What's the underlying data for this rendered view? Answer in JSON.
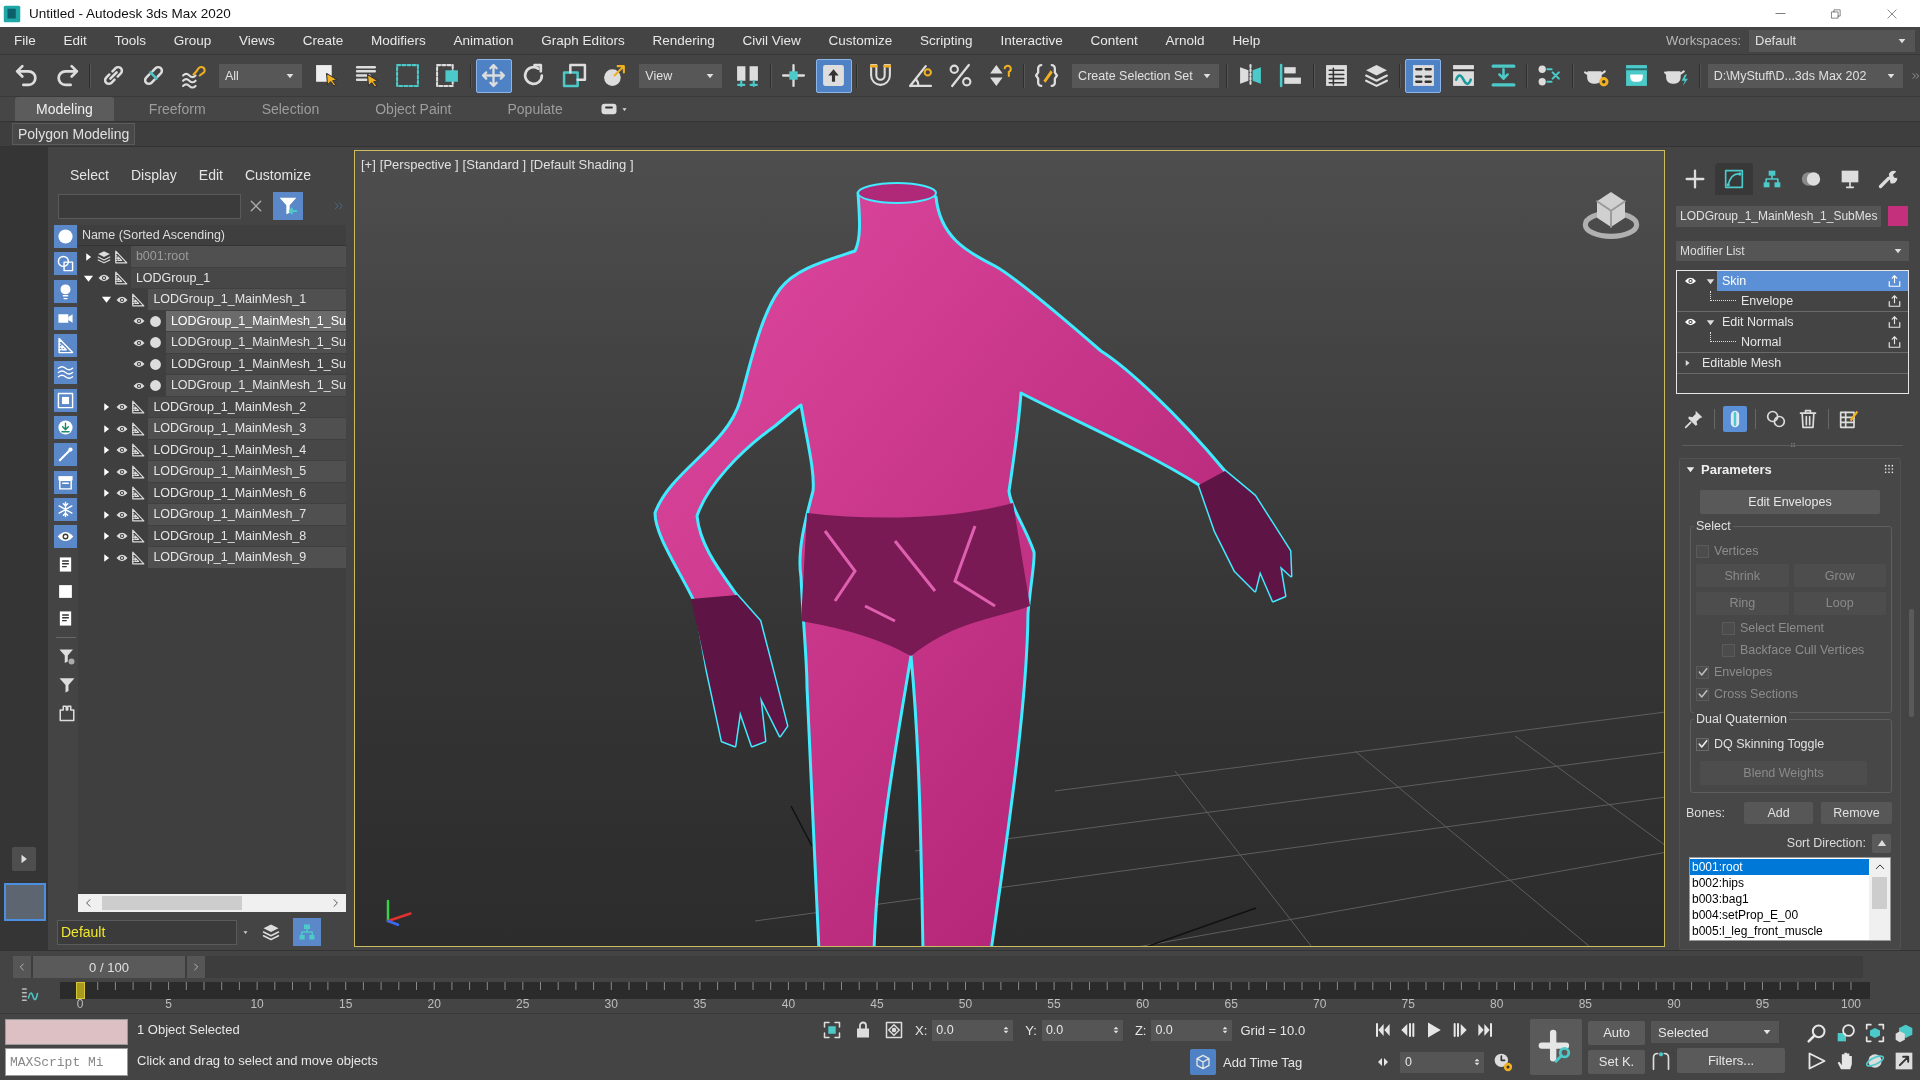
{
  "window": {
    "title": "Untitled - Autodesk 3ds Max 2020"
  },
  "menu_bar": {
    "items": [
      "File",
      "Edit",
      "Tools",
      "Group",
      "Views",
      "Create",
      "Modifiers",
      "Animation",
      "Graph Editors",
      "Rendering",
      "Civil View",
      "Customize",
      "Scripting",
      "Interactive",
      "Content",
      "Arnold",
      "Help"
    ],
    "workspaces_label": "Workspaces:",
    "workspace": "Default"
  },
  "main_toolbar": [
    {
      "kind": "button",
      "selected": false
    },
    {
      "kind": "button",
      "selected": false
    },
    {
      "kind": "separator"
    },
    {
      "kind": "button",
      "selected": false
    },
    {
      "kind": "button",
      "selected": false
    },
    {
      "kind": "button",
      "selected": false
    },
    {
      "kind": "dropdown",
      "value": "All"
    },
    {
      "kind": "button",
      "selected": false
    },
    {
      "kind": "button",
      "selected": false
    },
    {
      "kind": "button",
      "selected": false
    },
    {
      "kind": "button",
      "selected": false
    },
    {
      "kind": "separator"
    },
    {
      "kind": "button",
      "selected": true
    },
    {
      "kind": "button",
      "selected": false
    },
    {
      "kind": "button",
      "selected": false
    },
    {
      "kind": "button",
      "selected": false
    },
    {
      "kind": "dropdown",
      "value": "View"
    },
    {
      "kind": "button",
      "selected": false
    },
    {
      "kind": "separator"
    },
    {
      "kind": "button",
      "selected": false
    },
    {
      "kind": "button",
      "selected": true
    },
    {
      "kind": "separator"
    },
    {
      "kind": "button",
      "selected": false
    },
    {
      "kind": "button",
      "selected": false
    },
    {
      "kind": "button",
      "selected": false
    },
    {
      "kind": "button",
      "selected": false
    },
    {
      "kind": "separator"
    },
    {
      "kind": "button",
      "selected": false
    },
    {
      "kind": "dropdown",
      "value": "Create Selection Set"
    },
    {
      "kind": "separator"
    },
    {
      "kind": "button",
      "selected": false
    },
    {
      "kind": "button",
      "selected": false
    },
    {
      "kind": "separator"
    },
    {
      "kind": "button",
      "selected": false
    },
    {
      "kind": "button",
      "selected": false
    },
    {
      "kind": "separator"
    },
    {
      "kind": "button",
      "selected": true
    },
    {
      "kind": "button",
      "selected": false
    },
    {
      "kind": "button",
      "selected": false
    },
    {
      "kind": "separator"
    },
    {
      "kind": "button",
      "selected": false
    },
    {
      "kind": "separator"
    },
    {
      "kind": "button",
      "selected": false
    },
    {
      "kind": "button",
      "selected": false
    },
    {
      "kind": "button",
      "selected": false
    },
    {
      "kind": "separator"
    },
    {
      "kind": "dropdown",
      "value": "D:\\MyStuff\\D...3ds Max 202"
    }
  ],
  "ribbon": {
    "tabs": [
      {
        "label": "Modeling",
        "selected": true
      },
      {
        "label": "Freeform",
        "selected": false
      },
      {
        "label": "Selection",
        "selected": false
      },
      {
        "label": "Object Paint",
        "selected": false
      },
      {
        "label": "Populate",
        "selected": false
      }
    ],
    "panels": [
      "Polygon Modeling"
    ]
  },
  "viewport_layouts": [
    {
      "selected": true
    }
  ],
  "scene_explorer": {
    "menu": [
      "Select",
      "Display",
      "Edit",
      "Customize"
    ],
    "find_filter": {
      "selected": true
    },
    "filters": [
      {
        "on": true
      },
      {
        "on": true
      },
      {
        "on": true
      },
      {
        "on": true
      },
      {
        "on": true
      },
      {
        "on": true
      },
      {
        "on": true
      },
      {
        "on": true
      },
      {
        "on": true
      },
      {
        "on": true
      },
      {
        "on": true
      },
      {
        "on": true
      },
      {
        "on": false
      },
      {
        "on": false
      },
      {
        "on": false
      }
    ],
    "column": "Name (Sorted Ascending)",
    "tree": [
      {
        "name": "b001:root",
        "kind": "helper",
        "hidden": true,
        "expanded": false,
        "selected": false
      },
      {
        "name": "LODGroup_1",
        "kind": "helper",
        "hidden": false,
        "expanded": true,
        "selected": false,
        "children": [
          {
            "name": "LODGroup_1_MainMesh_1",
            "kind": "helper",
            "hidden": false,
            "expanded": true,
            "selected": false,
            "children": [
              {
                "name": "LODGroup_1_MainMesh_1_Su",
                "kind": "geometry",
                "hidden": false,
                "selected": true
              },
              {
                "name": "LODGroup_1_MainMesh_1_Su",
                "kind": "geometry",
                "hidden": false,
                "selected": false
              },
              {
                "name": "LODGroup_1_MainMesh_1_Su",
                "kind": "geometry",
                "hidden": false,
                "selected": false
              },
              {
                "name": "LODGroup_1_MainMesh_1_Su",
                "kind": "geometry",
                "hidden": false,
                "selected": false
              }
            ]
          },
          {
            "name": "LODGroup_1_MainMesh_2",
            "kind": "helper",
            "hidden": false,
            "expanded": false,
            "selected": false
          },
          {
            "name": "LODGroup_1_MainMesh_3",
            "kind": "helper",
            "hidden": false,
            "expanded": false,
            "selected": false
          },
          {
            "name": "LODGroup_1_MainMesh_4",
            "kind": "helper",
            "hidden": false,
            "expanded": false,
            "selected": false
          },
          {
            "name": "LODGroup_1_MainMesh_5",
            "kind": "helper",
            "hidden": false,
            "expanded": false,
            "selected": false
          },
          {
            "name": "LODGroup_1_MainMesh_6",
            "kind": "helper",
            "hidden": false,
            "expanded": false,
            "selected": false
          },
          {
            "name": "LODGroup_1_MainMesh_7",
            "kind": "helper",
            "hidden": false,
            "expanded": false,
            "selected": false
          },
          {
            "name": "LODGroup_1_MainMesh_8",
            "kind": "helper",
            "hidden": false,
            "expanded": false,
            "selected": false
          },
          {
            "name": "LODGroup_1_MainMesh_9",
            "kind": "helper",
            "hidden": false,
            "expanded": false,
            "selected": false
          }
        ]
      }
    ],
    "layer": "Default",
    "layer_tools": [
      {
        "selected": false
      },
      {
        "selected": true
      }
    ]
  },
  "viewport": {
    "labels": [
      "[+]",
      "[Perspective ]",
      "[Standard ]",
      "[Default Shading ]"
    ],
    "active": true
  },
  "command_panel": {
    "tabs": [
      {
        "selected": false
      },
      {
        "selected": true
      },
      {
        "selected": false
      },
      {
        "selected": false
      },
      {
        "selected": false
      },
      {
        "selected": false
      }
    ],
    "object": {
      "name": "LODGroup_1_MainMesh_1_SubMes",
      "color": "#c4307c"
    },
    "modifier_list": "Modifier List",
    "stack": [
      {
        "label": "Skin",
        "visible": true,
        "expanded": true,
        "selected": true,
        "children": [
          {
            "label": "Envelope",
            "selected": false
          }
        ]
      },
      {
        "label": "Edit Normals",
        "visible": true,
        "expanded": true,
        "selected": false,
        "children": [
          {
            "label": "Normal",
            "selected": false
          }
        ]
      },
      {
        "label": "Editable Mesh",
        "expanded": false,
        "selected": false
      }
    ],
    "stack_tools": [
      {
        "selected": false
      },
      {
        "selected": true
      },
      {
        "selected": false
      },
      {
        "selected": false
      },
      {
        "selected": false
      }
    ],
    "rollout": {
      "title": "Parameters",
      "expanded": true,
      "edit_button": "Edit Envelopes",
      "select_group": {
        "title": "Select",
        "items": [
          {
            "kind": "checkbox",
            "label": "Vertices",
            "checked": false,
            "disabled": true
          },
          {
            "kind": "pair",
            "labels": [
              "Shrink",
              "Grow"
            ],
            "disabled": true
          },
          {
            "kind": "pair",
            "labels": [
              "Ring",
              "Loop"
            ],
            "disabled": true
          },
          {
            "kind": "subcheckbox",
            "label": "Select Element",
            "checked": false,
            "disabled": true
          },
          {
            "kind": "subcheckbox",
            "label": "Backface Cull Vertices",
            "checked": false,
            "disabled": true
          },
          {
            "kind": "checkbox",
            "label": "Envelopes",
            "checked": true,
            "disabled": true
          },
          {
            "kind": "checkbox",
            "label": "Cross Sections",
            "checked": true,
            "disabled": true
          }
        ]
      },
      "dq_group": {
        "title": "Dual Quaternion",
        "items": [
          {
            "kind": "checkbox",
            "label": "DQ Skinning Toggle",
            "checked": true,
            "disabled": false
          },
          {
            "kind": "button",
            "label": "Blend Weights",
            "disabled": true
          }
        ]
      },
      "bones": {
        "label": "Bones:",
        "buttons": [
          "Add",
          "Remove"
        ],
        "sort_label": "Sort Direction:",
        "list": [
          {
            "name": "b001:root",
            "selected": true
          },
          {
            "name": "b002:hips",
            "selected": false
          },
          {
            "name": "b003:bag1",
            "selected": false
          },
          {
            "name": "b004:setProp_E_00",
            "selected": false
          },
          {
            "name": "b005:l_leg_front_muscle",
            "selected": false
          }
        ]
      }
    }
  },
  "timeline": {
    "frame": "0 / 100",
    "level": 0,
    "ruler": [
      "0",
      "5",
      "10",
      "15",
      "20",
      "25",
      "30",
      "35",
      "40",
      "45",
      "50",
      "55",
      "60",
      "65",
      "70",
      "75",
      "80",
      "85",
      "90",
      "95",
      "100"
    ]
  },
  "status_bar": {
    "listener": {
      "placeholder": "MAXScript Mi"
    },
    "selection": "1 Object Selected",
    "prompt": "Click and drag to select and move objects",
    "coords": [
      {
        "label": "X:",
        "value": "0.0"
      },
      {
        "label": "Y:",
        "value": "0.0"
      },
      {
        "label": "Z:",
        "value": "0.0"
      }
    ],
    "grid": "Grid = 10.0",
    "time_tag": "Add Time Tag",
    "frame": "0",
    "auto_key": {
      "label": "Auto",
      "on": false
    },
    "key_set": "Selected",
    "set_key": {
      "label": "Set K.",
      "on": false
    },
    "filters": "Filters..."
  }
}
